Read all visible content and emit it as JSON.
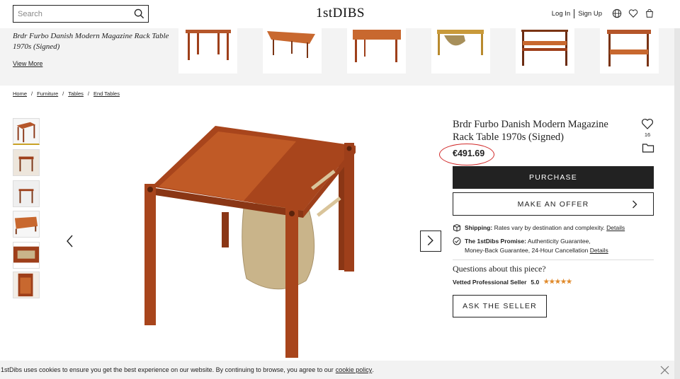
{
  "header": {
    "search_placeholder": "Search",
    "logo": "1stDIBS",
    "login": "Log In",
    "signup": "Sign Up"
  },
  "related": {
    "title": "Brdr Furbo Danish Modern Magazine Rack Table 1970s (Signed)",
    "view_more": "View More"
  },
  "breadcrumb": [
    "Home",
    "Furniture",
    "Tables",
    "End Tables"
  ],
  "product": {
    "title": "Brdr Furbo Danish Modern Magazine Rack Table 1970s (Signed)",
    "favorites_count": "16",
    "price": "€491.69",
    "purchase_label": "PURCHASE",
    "offer_label": "MAKE AN OFFER",
    "shipping_label": "Shipping:",
    "shipping_text": "Rates vary by destination and complexity.",
    "shipping_link": "Details",
    "promise_label": "The 1stDibs Promise:",
    "promise_text1": "Authenticity Guarantee,",
    "promise_text2": "Money-Back Guarantee, 24-Hour Cancellation",
    "promise_link": "Details",
    "questions": "Questions about this piece?",
    "seller_label": "Vetted Professional Seller",
    "rating": "5.0",
    "stars": "★★★★★",
    "ask_label": "ASK THE SELLER"
  },
  "cookie": {
    "text": "1stDibs uses cookies to ensure you get the best experience on our website. By continuing to browse, you agree to our",
    "link": "cookie policy",
    "end": "."
  },
  "colors": {
    "wood": "#9e3f1a",
    "wood_light": "#c8682f",
    "leather": "#c9b48a",
    "accent_circle": "#d12a2a",
    "star": "#e08a2c"
  }
}
